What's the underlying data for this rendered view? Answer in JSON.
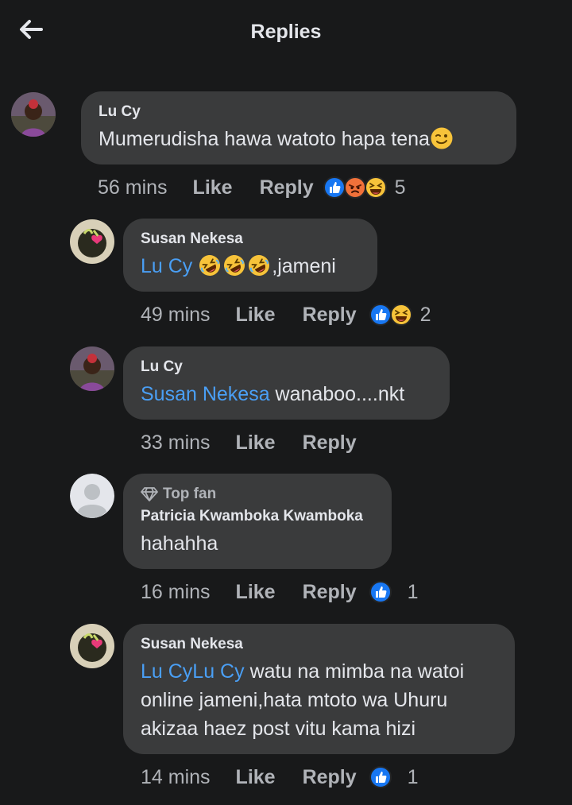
{
  "header": {
    "title": "Replies"
  },
  "comments": [
    {
      "author": "Lu Cy",
      "text": "Mumerudisha hawa watoto hapa tena",
      "time": "56 mins",
      "like_label": "Like",
      "reply_label": "Reply",
      "reaction_count": "5",
      "reactions": [
        "like-icon",
        "angry-icon",
        "laugh-icon"
      ]
    },
    {
      "author": "Susan Nekesa",
      "mention": "Lu Cy",
      "text": ",jameni",
      "time": "49 mins",
      "like_label": "Like",
      "reply_label": "Reply",
      "reaction_count": "2",
      "reactions": [
        "like-icon",
        "laugh-icon"
      ]
    },
    {
      "author": "Lu Cy",
      "mention": "Susan Nekesa",
      "text": " wanaboo....nkt",
      "time": "33 mins",
      "like_label": "Like",
      "reply_label": "Reply"
    },
    {
      "badge": "Top fan",
      "author": "Patricia Kwamboka Kwamboka",
      "text": "hahahha",
      "time": "16 mins",
      "like_label": "Like",
      "reply_label": "Reply",
      "reaction_count": "1",
      "reactions": [
        "like-icon"
      ]
    },
    {
      "author": "Susan Nekesa",
      "mention": "Lu CyLu Cy",
      "text": " watu na mimba na watoi online jameni,hata mtoto wa Uhuru akizaa haez post vitu kama hizi",
      "time": "14 mins",
      "like_label": "Like",
      "reply_label": "Reply",
      "reaction_count": "1",
      "reactions": [
        "like-icon"
      ]
    }
  ],
  "colors": {
    "background": "#18191a",
    "bubble": "#3a3b3c",
    "mention": "#4a9ff5",
    "like": "#1877f2",
    "secondary_text": "#b0b3b8"
  }
}
